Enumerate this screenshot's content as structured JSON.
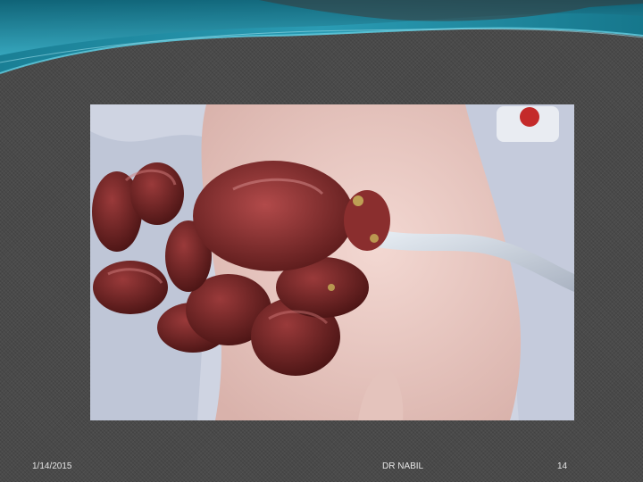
{
  "footer": {
    "date": "1/14/2015",
    "author": "DR NABIL",
    "page_number": "14"
  },
  "colors": {
    "background": "#4a4a4a",
    "header_teal_dark": "#0f5f73",
    "header_teal_light": "#3aa8c0",
    "footer_text": "#e6e6e6"
  }
}
